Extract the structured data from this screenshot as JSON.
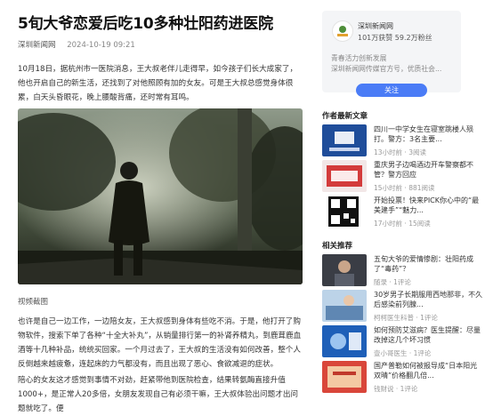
{
  "article": {
    "title": "5旬大爷恋爱后吃10多种壮阳药进医院",
    "source": "深圳新闻网",
    "date": "2024-10-19 09:21",
    "para1": "10月18日，据杭州市一医院消息，王大叔老伴儿走得早，如今孩子们长大成家了，他也开启自己的新生活，还找到了对他照顾有加的女友。可是王大叔总感觉身体很累，白天头昏眼花，晚上腰酸背痛，还时常有耳鸣。",
    "caption": "视频截图",
    "para2": "也许是自己一边工作，一边陪女友，王大叔感到身体有些吃不消。于是，他打开了购物软件，搜索下单了各种“十全大补丸”，从销量排行第一的补肾养精丸，到鹿茸鹿血酒等十几种补品，统统买回家。一个月过去了，王大叔的生活没有如何改善，整个人反倒越来越疲惫，连起床的力气都没有，而且出现了恶心、食欲减退的症状。",
    "para3": "陪心的女友这才感觉到事情不对劲，赶紧带他到医院检查，结果转氨酶直接升值1000+，是正常人20多倍，女朋友发现自己有必须干嘛，王大叔体验出问题才出问题就吃了。便"
  },
  "author_card": {
    "name": "深圳新闻网",
    "stats": "101万获赞 59.2万粉丝",
    "desc_line1": "青春活力创新发展",
    "desc_line2": "深圳新闻网传媒官方号，优质社会...",
    "follow_label": "关注"
  },
  "author_latest": {
    "heading": "作者最新文章",
    "items": [
      {
        "title": "四川一中学女生在寝室跳楼人殒打。警方：3名主要...",
        "views": "13小时前",
        "comments": "3阅读"
      },
      {
        "title": "重庆男子边喝酒边开车警察都不管？警方回应",
        "views": "15小时前",
        "comments": "881阅读"
      },
      {
        "title": "开始投票！快来PICK你心中的“最美建手”“魅力...",
        "views": "17小时前",
        "comments": "15阅读"
      }
    ]
  },
  "related": {
    "heading": "相关推荐",
    "items": [
      {
        "title": "五旬大爷的爱情惨剧：壮阳药成了“毒药”？",
        "author": "随录",
        "comments": "1评论"
      },
      {
        "title": "30岁男子长期服用西地那非，不久后感染前列腺...",
        "author": "柯柯医生科普",
        "comments": "1评论"
      },
      {
        "title": "如何预防艾滋病？医生提醒：尽量改掉这几个坏习惯",
        "author": "壹小哥医生",
        "comments": "1评论"
      },
      {
        "title": "国产普勒如何被报导成“日本阳光双晴”价格翻几倍...",
        "author": "钱财说",
        "comments": "1评论"
      }
    ]
  },
  "colors": {
    "accent": "#4a7cf6",
    "card_bg": "#f4f5f7"
  }
}
